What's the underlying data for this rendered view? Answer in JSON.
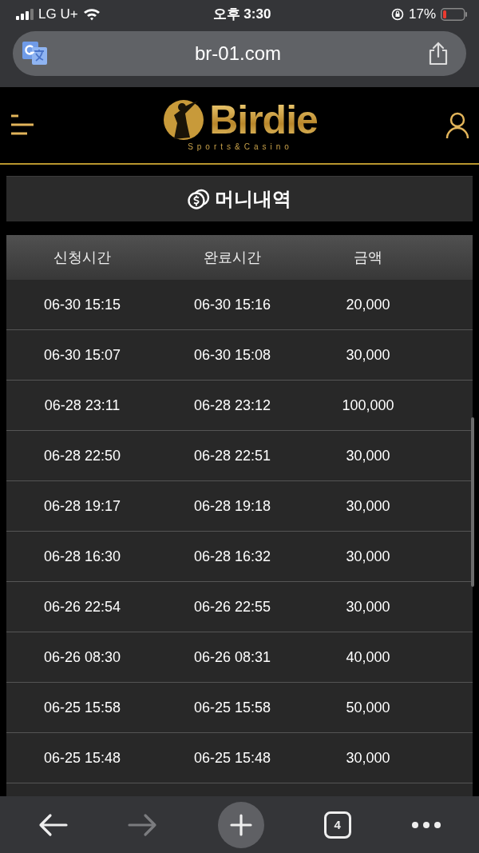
{
  "status_bar": {
    "carrier": "LG U+",
    "time": "오후 3:30",
    "battery": "17%"
  },
  "address_bar": {
    "url": "br-01.com"
  },
  "header": {
    "logo": "Birdie",
    "tagline": "Sports&Casino"
  },
  "page_title": "머니내역",
  "table": {
    "columns": [
      "신청시간",
      "완료시간",
      "금액"
    ],
    "rows": [
      [
        "06-30 15:15",
        "06-30 15:16",
        "20,000"
      ],
      [
        "06-30 15:07",
        "06-30 15:08",
        "30,000"
      ],
      [
        "06-28 23:11",
        "06-28 23:12",
        "100,000"
      ],
      [
        "06-28 22:50",
        "06-28 22:51",
        "30,000"
      ],
      [
        "06-28 19:17",
        "06-28 19:18",
        "30,000"
      ],
      [
        "06-28 16:30",
        "06-28 16:32",
        "30,000"
      ],
      [
        "06-26 22:54",
        "06-26 22:55",
        "30,000"
      ],
      [
        "06-26 08:30",
        "06-26 08:31",
        "40,000"
      ],
      [
        "06-25 15:58",
        "06-25 15:58",
        "50,000"
      ],
      [
        "06-25 15:48",
        "06-25 15:48",
        "30,000"
      ]
    ]
  },
  "toolbar": {
    "back_disabled": false,
    "forward_disabled": true,
    "tab_count": "4"
  }
}
